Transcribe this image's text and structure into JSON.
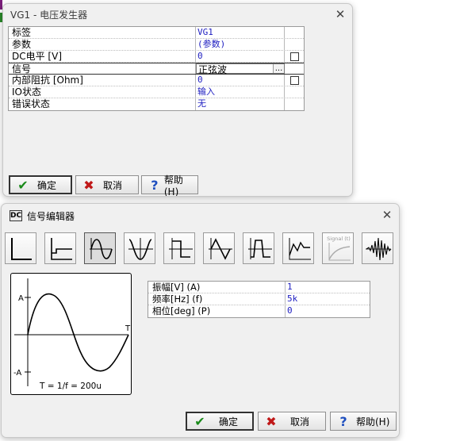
{
  "vg1_dialog": {
    "title": "VG1 - 电压发生器",
    "rows": [
      {
        "label": "标签",
        "value": "VG1",
        "checkbox": false
      },
      {
        "label": "参数",
        "value": "(参数)",
        "checkbox": false
      },
      {
        "label": "DC电平 [V]",
        "value": "0",
        "checkbox": true
      },
      {
        "label": "信号",
        "value": "正弦波",
        "checkbox": false,
        "selected": true
      },
      {
        "label": "内部阻抗 [Ohm]",
        "value": "0",
        "checkbox": true
      },
      {
        "label": "IO状态",
        "value": "输入",
        "checkbox": false
      },
      {
        "label": "错误状态",
        "value": "无",
        "checkbox": false
      }
    ],
    "ellipsis": "...",
    "ok_label": "确定",
    "cancel_label": "取消",
    "help_label": "帮助(H)"
  },
  "signal_editor": {
    "title": "信号编辑器",
    "title_icon_text": "DC",
    "waveform_buttons": [
      {
        "name": "step",
        "pressed": false
      },
      {
        "name": "dc-step",
        "pressed": false
      },
      {
        "name": "sine",
        "pressed": true
      },
      {
        "name": "cosine",
        "pressed": false
      },
      {
        "name": "square",
        "pressed": false
      },
      {
        "name": "triangle",
        "pressed": false
      },
      {
        "name": "pulse",
        "pressed": false
      },
      {
        "name": "piecewise",
        "pressed": false
      },
      {
        "name": "signal-f-disabled",
        "pressed": false,
        "label": "Signal (t)"
      },
      {
        "name": "burst",
        "pressed": false
      }
    ],
    "preview": {
      "label_amp": "A",
      "label_neg_amp": "-A",
      "label_period": "T",
      "formula": "T = 1/f = 200u"
    },
    "params": [
      {
        "label": "振幅[V] (A)",
        "value": "1"
      },
      {
        "label": "频率[Hz] (f)",
        "value": "5k"
      },
      {
        "label": "相位[deg] (P)",
        "value": "0"
      }
    ],
    "ok_label": "确定",
    "cancel_label": "取消",
    "help_label": "帮助(H)"
  },
  "colors": {
    "value_blue": "#1c1cc0",
    "ok_green": "#1a8a1a",
    "cancel_red": "#c01818",
    "help_blue": "#1f4fbf"
  }
}
